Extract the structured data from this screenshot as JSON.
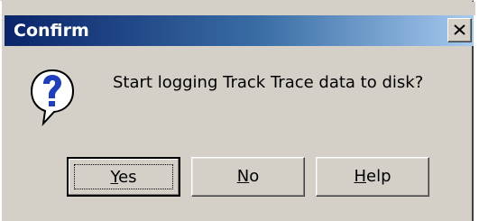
{
  "window": {
    "title": "Confirm",
    "close_icon": "close-icon"
  },
  "message": {
    "icon": "question-icon",
    "text": "Start logging Track Trace data to disk?"
  },
  "buttons": {
    "yes": {
      "mnemonic": "Y",
      "rest": "es",
      "default": true
    },
    "no": {
      "mnemonic": "N",
      "rest": "o"
    },
    "help": {
      "mnemonic": "H",
      "rest": "elp"
    }
  },
  "colors": {
    "titlebar_start": "#0a246a",
    "titlebar_end": "#a6caf0",
    "dialog_bg": "#d4d0c8"
  }
}
